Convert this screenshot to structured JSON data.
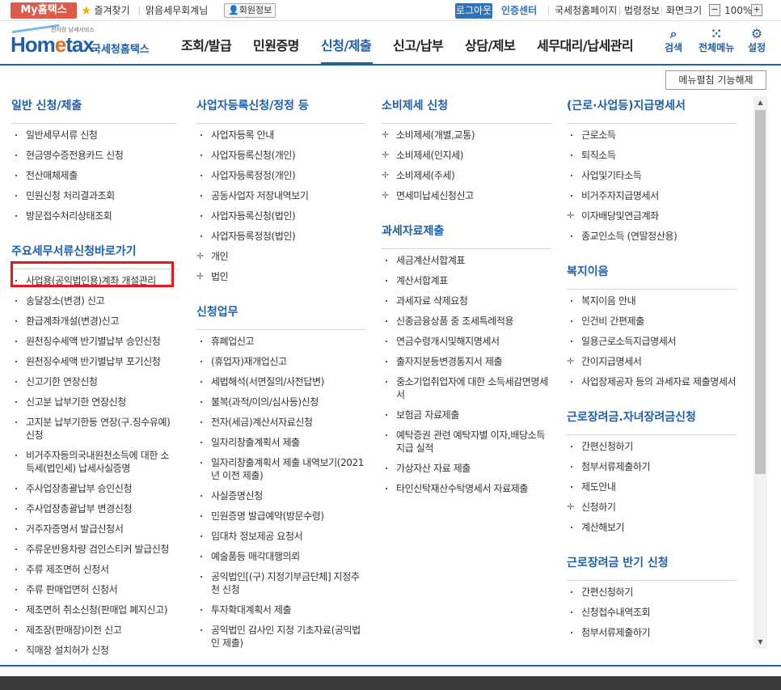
{
  "topbar": {
    "my_home": "My홈택스",
    "favorites": "즐겨찾기",
    "user_name": "맑음세무회계님",
    "member_info": "회원정보",
    "logout": "로그아웃",
    "cert_center": "인증센터",
    "links": [
      "국세청홈페이지",
      "법령정보",
      "화면크기"
    ],
    "zoom": "100%",
    "zoom_minus": "−",
    "zoom_plus": "+"
  },
  "header": {
    "logo_text_a": "Hom",
    "logo_text_e": "e",
    "logo_text_b": "tax",
    "logo_sub": "전자정 남세서비스",
    "logo_kr": "국세청홈택스",
    "nav": [
      "조회/발급",
      "민원증명",
      "신청/제출",
      "신고/납부",
      "상담/제보",
      "세무대리/납세관리"
    ],
    "active_nav_index": 2,
    "icons": [
      {
        "label": "검색",
        "icon": "search-icon"
      },
      {
        "label": "전체메뉴",
        "icon": "grid-menu-icon"
      },
      {
        "label": "설정",
        "icon": "gear-icon"
      }
    ]
  },
  "menu_close_button": "메뉴펼침 기능해제",
  "columns": [
    {
      "sections": [
        {
          "title": "일반 신청/제출",
          "items": [
            "일반세무서류 신청",
            "현금영수증전용카드 신청",
            "전산매체제출",
            "민원신청 처리결과조회",
            "방문접수처리상태조회"
          ]
        },
        {
          "title": "주요세무서류신청바로가기",
          "items": [
            "사업용(공익법인용)계좌 개설관리",
            "송달장소(변경) 신고",
            "환급계좌개설(변경)신고",
            "원천징수세액 반기별납부 승인신청",
            "원천징수세액 반기별납부 포기신청",
            "신고기한 연장신청",
            "신고분 납부기한 연장신청",
            "고지분 납부기한등 연장(구.징수유예) 신청",
            "비거주자등의국내원천소득에 대한 소득세(법인세) 납세사실증명",
            "주사업장총괄납부 승인신청",
            "주사업장총괄납부 변경신청",
            "거주자증명서 발급신청서",
            "주류운반용차량 검인스티커 발급신청",
            "주류 제조면허 신청서",
            "주류 판매업면허 신청서",
            "제조면허 취소신청(판매업 폐지신고)",
            "제조장(판매장)이전 신고",
            "직매장 설치허가 신청"
          ]
        }
      ]
    },
    {
      "sections": [
        {
          "title": "사업자등록신청/정정 등",
          "items": [
            "사업자등록 안내",
            "사업자등록신청(개인)",
            "사업자등록정정(개인)",
            "공동사업자 저장내역보기",
            "사업자등록신청(법인)",
            "사업자등록정정(법인)",
            "개인",
            "법인"
          ]
        },
        {
          "title": "신청업무",
          "items": [
            "휴폐업신고",
            "(휴업자)재개업신고",
            "세법해석(서면질의/사전답변)",
            "불복(과적/이의/심사등)신청",
            "전자(세금)계산서자료신청",
            "일자리창출계획서 제출",
            "일자리창출계획서 제출 내역보기(2021년 이전 제출)",
            "사실증명신청",
            "민원증명 발급예약(방문수령)",
            "임대차 정보제공 요청서",
            "예술품등 매각대행의뢰",
            "공익법인[(구) 지정기부금단체] 지정추천 신청",
            "투자확대계획서 제출",
            "공익법인 감사인 지정 기초자료(공익법인 제출)"
          ]
        }
      ]
    },
    {
      "sections": [
        {
          "title": "소비제세 신청",
          "items": [
            "소비제세(개별,교통)",
            "소비제세(인지세)",
            "소비제세(주세)",
            "면세미납세신청신고"
          ]
        },
        {
          "title": "과세자료제출",
          "items": [
            "세금계산서합계표",
            "계산서합계표",
            "과세자료 삭제요청",
            "신종금융상품 중 조세특례적용",
            "연금수령개시및해지명세서",
            "출자지분등변경통지서 제출",
            "중소기업취업자에 대한 소득세감면명세서",
            "보험금 자료제출",
            "예탁증권 관련 예탁자별 이자,배당소득 지급 실적",
            "가상자산 자료 제출",
            "타인신탁재산수탁명세서 자료제출"
          ]
        }
      ]
    },
    {
      "sections": [
        {
          "title": "(근로·사업등)지급명세서",
          "items": [
            "근로소득",
            "퇴직소득",
            "사업및기타소득",
            "비거주자지급명세서",
            "이자배당및연금계좌",
            "종교인소득 (연말정산용)"
          ]
        },
        {
          "title": "복지이음",
          "items": [
            "복지이음 안내",
            "인건비 간편제출",
            "일용근로소득지급명세서",
            "간이지급명세서",
            "사업장제공자 등의 과세자료 제출명세서"
          ]
        },
        {
          "title": "근로장려금.자녀장려금신청",
          "items": [
            "간편신청하기",
            "첨부서류제출하기",
            "제도안내",
            "신청하기",
            "계산해보기"
          ]
        },
        {
          "title": "근로장려금 반기 신청",
          "items": [
            "간편신청하기",
            "신청접수내역조회",
            "첨부서류제출하기"
          ]
        }
      ]
    }
  ]
}
